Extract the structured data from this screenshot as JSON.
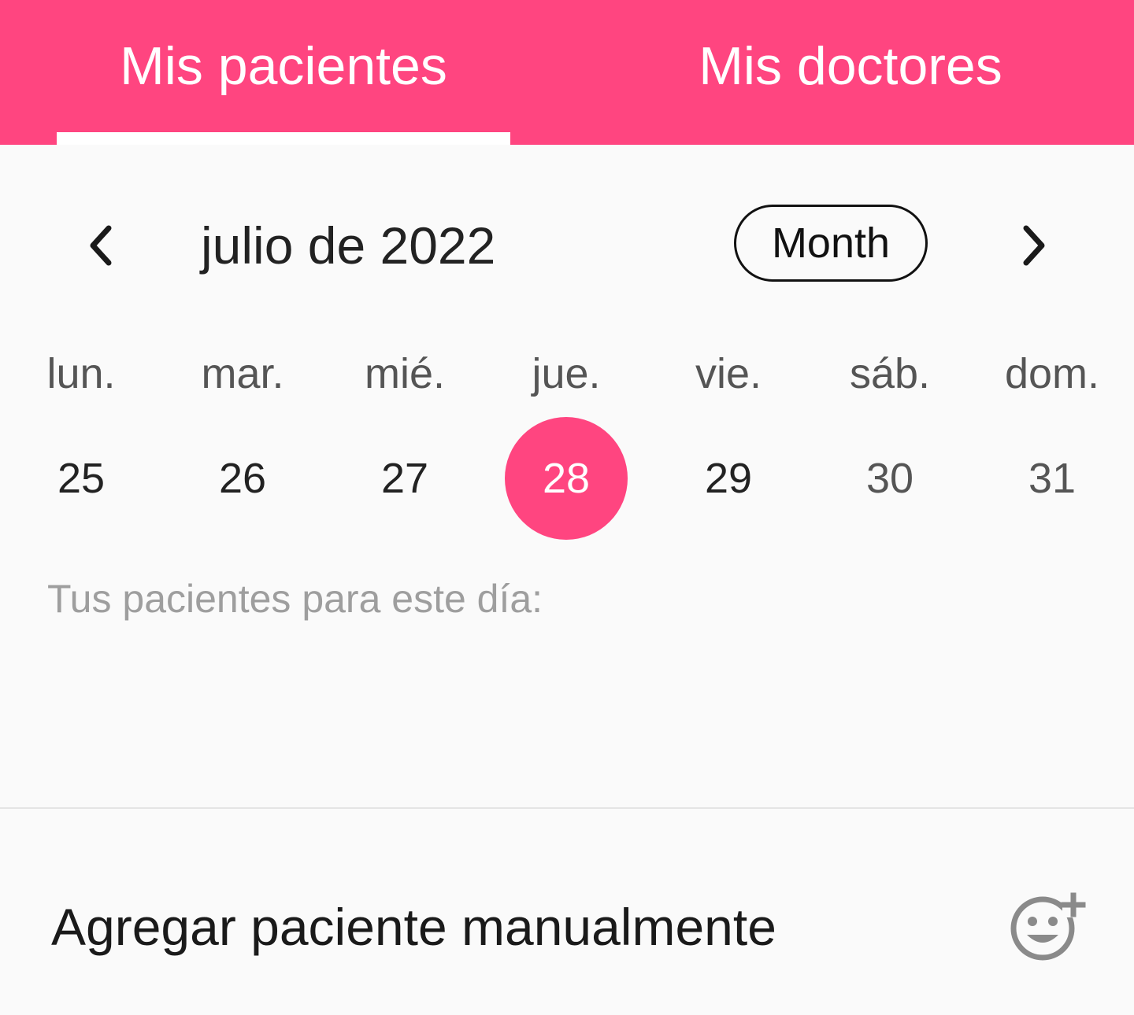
{
  "tabs": [
    {
      "label": "Mis pacientes",
      "selected": true
    },
    {
      "label": "Mis doctores",
      "selected": false
    }
  ],
  "calendar": {
    "title": "julio de 2022",
    "view_toggle": "Month",
    "weekdays": [
      "lun.",
      "mar.",
      "mié.",
      "jue.",
      "vie.",
      "sáb.",
      "dom."
    ],
    "days": [
      "25",
      "26",
      "27",
      "28",
      "29",
      "30",
      "31"
    ],
    "selected_day": "28"
  },
  "patients_label": "Tus pacientes para este día:",
  "add_patient": {
    "label": "Agregar paciente manualmente",
    "icon": "add-reaction-icon"
  },
  "colors": {
    "accent": "#ff4580",
    "background": "#fafafa"
  },
  "icons": {
    "prev": "chevron-left-icon",
    "next": "chevron-right-icon"
  }
}
